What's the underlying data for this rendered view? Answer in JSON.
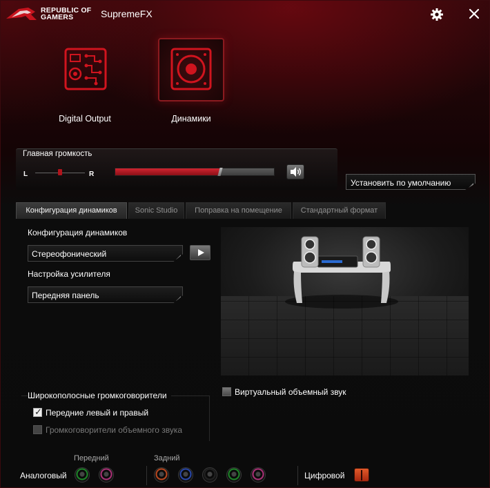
{
  "titlebar": {
    "brand_line1": "REPUBLIC OF",
    "brand_line2": "GAMERS",
    "app_title": "SupremeFX"
  },
  "devices": [
    {
      "label": "Digital Output",
      "icon": "digital-output-icon",
      "active": false
    },
    {
      "label": "Динамики",
      "icon": "speaker-icon",
      "active": true
    }
  ],
  "volume": {
    "title": "Главная громкость",
    "left_label": "L",
    "right_label": "R",
    "level_percent": 66,
    "balance_percent": 50
  },
  "default_button": "Установить по умолчанию",
  "tabs": [
    {
      "label": "Конфигурация динамиков",
      "active": true
    },
    {
      "label": "Sonic Studio",
      "active": false
    },
    {
      "label": "Поправка на помещение",
      "active": false
    },
    {
      "label": "Стандартный формат",
      "active": false
    }
  ],
  "config": {
    "speaker_config_label": "Конфигурация динамиков",
    "speaker_config_value": "Стереофонический",
    "amp_label": "Настройка усилителя",
    "amp_value": "Передняя панель"
  },
  "wideband": {
    "title": "Широкополосные громкоговорители",
    "front_lr": "Передние левый и правый",
    "front_lr_checked": true,
    "surround": "Громкоговорители объемного звука",
    "surround_enabled": false
  },
  "virtual_surround": {
    "label": "Виртуальный объемный звук",
    "checked": false
  },
  "jacks": {
    "front_label": "Передний",
    "rear_label": "Задний",
    "analog_label": "Аналоговый",
    "digital_label": "Цифровой",
    "front_colors": [
      "#1f8a2a",
      "#b0327a"
    ],
    "rear_colors": [
      "#c04a20",
      "#2a4ab0",
      "#222222",
      "#1f8a2a",
      "#b0327a"
    ]
  },
  "colors": {
    "accent": "#c8141e",
    "accent_dark": "#8a1017"
  }
}
